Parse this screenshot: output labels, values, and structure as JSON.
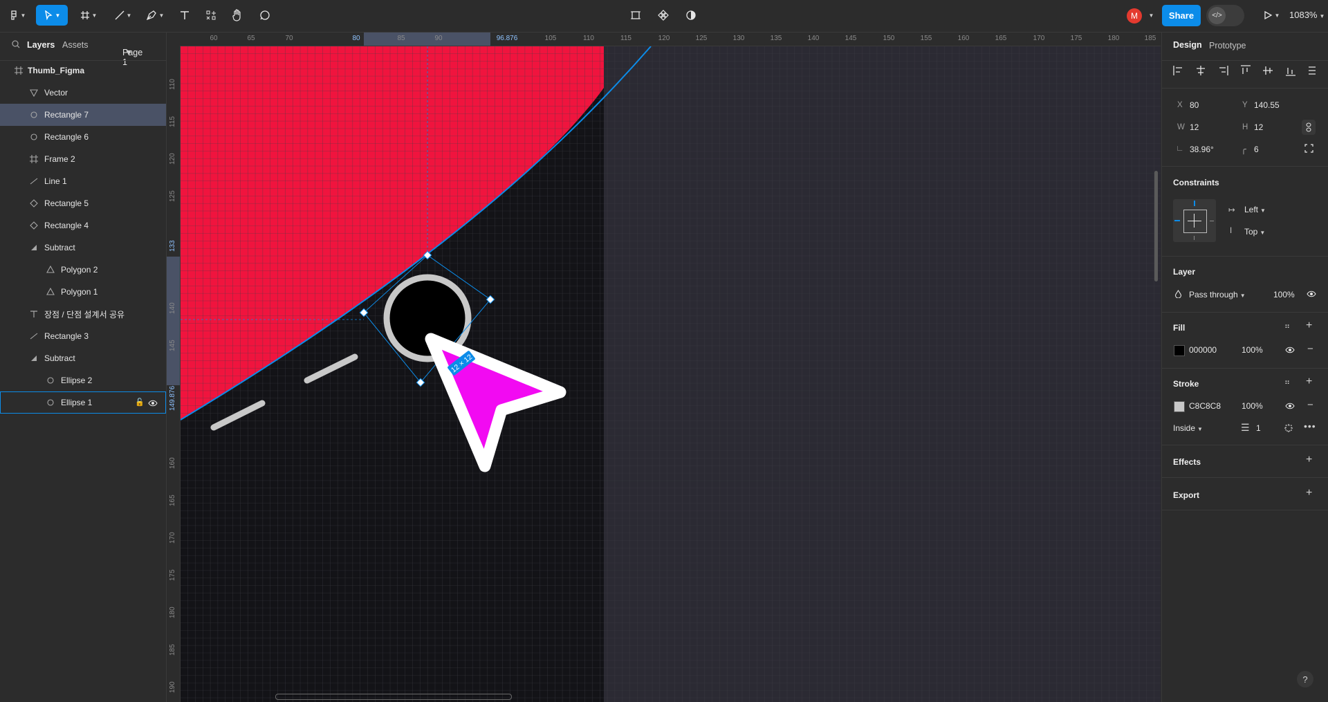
{
  "toolbar": {
    "share_label": "Share",
    "avatar_initial": "M",
    "zoom_label": "1083%"
  },
  "left_panel": {
    "tab_layers": "Layers",
    "tab_assets": "Assets",
    "page_label": "Page 1",
    "layers": [
      {
        "label": "Thumb_Figma",
        "icon": "frame-icon"
      },
      {
        "label": "Vector",
        "icon": "vector-icon"
      },
      {
        "label": "Rectangle 7",
        "icon": "ellipse-icon",
        "selected": true
      },
      {
        "label": "Rectangle 6",
        "icon": "ellipse-icon"
      },
      {
        "label": "Frame 2",
        "icon": "frame-icon"
      },
      {
        "label": "Line 1",
        "icon": "line-icon"
      },
      {
        "label": "Rectangle 5",
        "icon": "diamond-icon"
      },
      {
        "label": "Rectangle 4",
        "icon": "diamond-icon"
      },
      {
        "label": "Subtract",
        "icon": "subtract-icon"
      },
      {
        "label": "Polygon 2",
        "icon": "triangle-icon"
      },
      {
        "label": "Polygon 1",
        "icon": "triangle-icon"
      },
      {
        "label": "장점 / 단점 설계서 공유",
        "icon": "text-icon"
      },
      {
        "label": "Rectangle 3",
        "icon": "line-icon"
      },
      {
        "label": "Subtract",
        "icon": "subtract-icon"
      },
      {
        "label": "Ellipse 2",
        "icon": "ellipse-icon"
      },
      {
        "label": "Ellipse 1",
        "icon": "ellipse-icon",
        "hovered": true
      }
    ]
  },
  "ruler": {
    "top_ticks": [
      "60",
      "65",
      "70",
      "80",
      "85",
      "90",
      "96.876",
      "105",
      "110",
      "115",
      "120",
      "125",
      "130",
      "135",
      "140",
      "145",
      "150",
      "155",
      "160",
      "165",
      "170",
      "175",
      "180",
      "185"
    ],
    "left_ticks": [
      "110",
      "115",
      "120",
      "125",
      "133",
      "140",
      "145",
      "149.876",
      "160",
      "165",
      "170",
      "175",
      "180",
      "185",
      "190"
    ]
  },
  "canvas": {
    "size_badge": "12 × 12",
    "colors": {
      "red": "#f0143e",
      "magenta": "#f20af2",
      "ring": "#c8c8c8",
      "accent": "#0c8ce9"
    }
  },
  "right_panel": {
    "tab_design": "Design",
    "tab_prototype": "Prototype",
    "x_label": "X",
    "x_value": "80",
    "y_label": "Y",
    "y_value": "140.55",
    "w_label": "W",
    "w_value": "12",
    "h_label": "H",
    "h_value": "12",
    "rotation_value": "38.96°",
    "radius_value": "6",
    "constraints_title": "Constraints",
    "constraint_h": "Left",
    "constraint_v": "Top",
    "layer_title": "Layer",
    "blend_mode": "Pass through",
    "layer_opacity": "100%",
    "fill_title": "Fill",
    "fill_hex": "000000",
    "fill_opacity": "100%",
    "fill_color": "#000000",
    "stroke_title": "Stroke",
    "stroke_hex": "C8C8C8",
    "stroke_opacity": "100%",
    "stroke_color": "#c8c8c8",
    "stroke_position": "Inside",
    "stroke_weight": "1",
    "effects_title": "Effects",
    "export_title": "Export"
  }
}
